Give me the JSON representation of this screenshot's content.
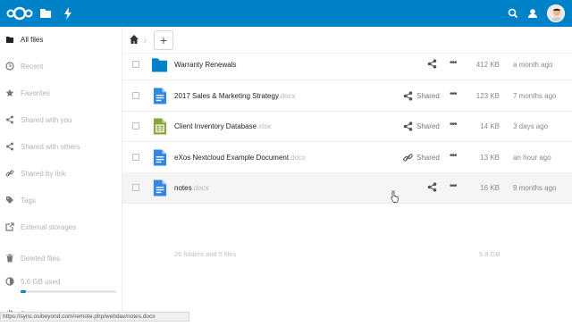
{
  "header": {
    "brand_color": "#0082c9",
    "icons": [
      "nextcloud-logo-icon",
      "files-icon",
      "activity-icon",
      "search-icon",
      "contacts-icon"
    ]
  },
  "sidebar": {
    "items": [
      {
        "label": "All files",
        "icon": "folder-icon",
        "active": true
      },
      {
        "label": "Recent",
        "icon": "clock-icon"
      },
      {
        "label": "Favorites",
        "icon": "star-icon"
      },
      {
        "label": "Shared with you",
        "icon": "share-icon"
      },
      {
        "label": "Shared with others",
        "icon": "share-icon"
      },
      {
        "label": "Shared by link",
        "icon": "link-icon"
      },
      {
        "label": "Tags",
        "icon": "tag-icon"
      },
      {
        "label": "External storages",
        "icon": "external-icon"
      },
      {
        "label": "Deleted files",
        "icon": "trash-icon"
      }
    ],
    "quota": {
      "label": "5.6 GB used",
      "fraction": 0.06
    },
    "settings_label": "Settings"
  },
  "statusbar": {
    "url": "https://sync.osibeyond.com/remote.php/webdav/notes.docx"
  },
  "toolbar": {
    "add_label": "+"
  },
  "files": [
    {
      "name": "Warranty Renewals",
      "ext": "",
      "type": "folder",
      "shared_label": "",
      "share_icon": "share-icon",
      "size": "412 KB",
      "modified": "a month ago"
    },
    {
      "name": "2017 Sales & Marketing Strategy",
      "ext": ".docx",
      "type": "doc",
      "shared_label": "Shared",
      "share_icon": "share-icon",
      "size": "123 KB",
      "modified": "7 months ago"
    },
    {
      "name": "Client Inventory Database",
      "ext": ".xlsx",
      "type": "sheet",
      "shared_label": "Shared",
      "share_icon": "share-icon",
      "size": "14 KB",
      "modified": "3 days ago"
    },
    {
      "name": "eXos Nextcloud Example Document",
      "ext": ".docx",
      "type": "doc",
      "shared_label": "Shared",
      "share_icon": "link-icon",
      "size": "13 KB",
      "modified": "an hour ago"
    },
    {
      "name": "notes",
      "ext": ".docx",
      "type": "doc",
      "shared_label": "",
      "share_icon": "share-icon",
      "size": "16 KB",
      "modified": "9 months ago"
    }
  ],
  "summary": {
    "text": "26 folders and 5 files",
    "size": "5.9 GB"
  }
}
